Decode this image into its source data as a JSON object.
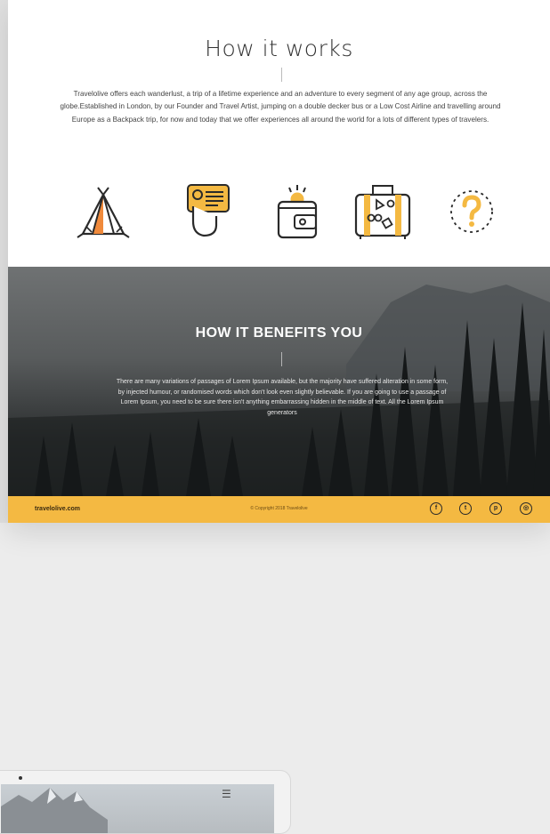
{
  "how_it_works": {
    "title": "How it works",
    "text": "Travelolive offers each wanderlust, a trip of a lifetime experience and an adventure to every segment of any age group, across the globe.Established in London, by our Founder and Travel Artist, jumping on a double decker bus or a Low Cost Airline and travelling around Europe as a Backpack trip, for now and today that we offer experiences all around the world for a lots of different types of travelers.",
    "icons": [
      "tent-icon",
      "id-card-hand-icon",
      "wallet-coin-icon",
      "suitcase-stickers-icon",
      "question-mark-icon"
    ]
  },
  "benefits": {
    "title": "HOW IT BENEFITS YOU",
    "text": "There are many variations of passages of Lorem Ipsum available, but the majority have suffered alteration in some form, by injected humour, or randomised words which don't look even slightly believable. If you are going to use a passage of Lorem Ipsum, you need to be sure there isn't anything embarrassing hidden in the middle of text. All the Lorem Ipsum generators"
  },
  "footer": {
    "site": "travelolive.com",
    "copyright": "© Copyright 2018 Travelolive",
    "social": [
      {
        "name": "facebook-icon",
        "glyph": "f"
      },
      {
        "name": "twitter-icon",
        "glyph": "t"
      },
      {
        "name": "pinterest-icon",
        "glyph": "p"
      },
      {
        "name": "instagram-icon",
        "glyph": "◎"
      }
    ]
  },
  "colors": {
    "accent": "#f4b942",
    "dark": "#333333"
  }
}
